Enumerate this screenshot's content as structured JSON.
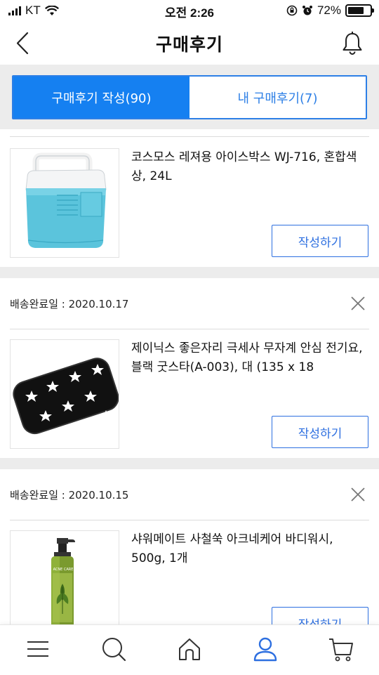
{
  "status_bar": {
    "carrier": "KT",
    "time": "오전 2:26",
    "battery_percent": "72%",
    "battery_level": 0.72
  },
  "header": {
    "title": "구매후기",
    "back_icon": "chevron-left-icon",
    "bell_icon": "bell-icon"
  },
  "tabs": [
    {
      "label": "구매후기 작성(90)",
      "active": true
    },
    {
      "label": "내 구매후기(7)",
      "active": false
    }
  ],
  "items": [
    {
      "delivery_date": "",
      "product_name": "코스모스 레져용 아이스박스 WJ-716, 혼합색상, 24L",
      "button_label": "작성하기",
      "thumbnail_icon": "icebox-image"
    },
    {
      "delivery_date": "배송완료일 : 2020.10.17",
      "product_name": "제이닉스 좋은자리 극세사 무자계 안심 전기요, 블랙 굿스타(A-003), 대 (135 x 18",
      "button_label": "작성하기",
      "thumbnail_icon": "black-star-blanket-image"
    },
    {
      "delivery_date": "배송완료일 : 2020.10.15",
      "product_name": "샤워메이트 사철쑥 아크네케어 바디워시, 500g, 1개",
      "button_label": "작성하기",
      "thumbnail_icon": "body-wash-bottle-image",
      "thumbnail_text": "ACNE CARE"
    }
  ],
  "bottom_nav": [
    {
      "name": "menu-icon",
      "active": false
    },
    {
      "name": "search-icon",
      "active": false
    },
    {
      "name": "home-icon",
      "active": false
    },
    {
      "name": "profile-icon",
      "active": true
    },
    {
      "name": "cart-icon",
      "active": false
    }
  ],
  "colors": {
    "accent": "#1580f1",
    "button_border": "#2d6fe0",
    "separator": "#ececec"
  }
}
